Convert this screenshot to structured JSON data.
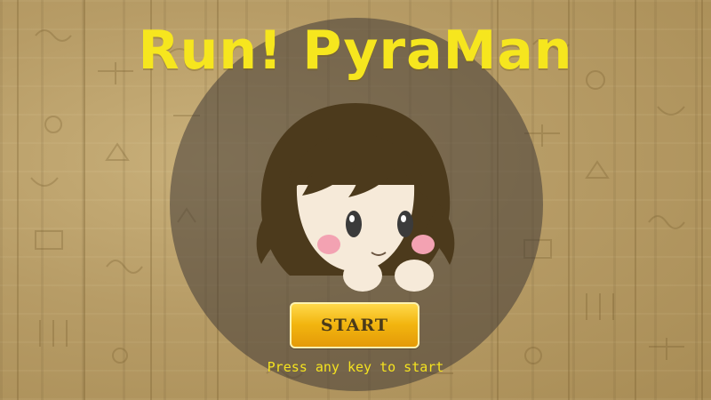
{
  "game": {
    "title": "Run! PyraMan",
    "start_label": "START",
    "hint": "Press any key to start"
  },
  "colors": {
    "title": "#f6e61e",
    "hint": "#f4e21f",
    "button_top": "#ffd94a",
    "button_bottom": "#e49a08",
    "halo": "#413a37",
    "background": "#b79c66"
  },
  "icons": [
    "hieroglyph-wall-background",
    "pyraman-character-face"
  ]
}
